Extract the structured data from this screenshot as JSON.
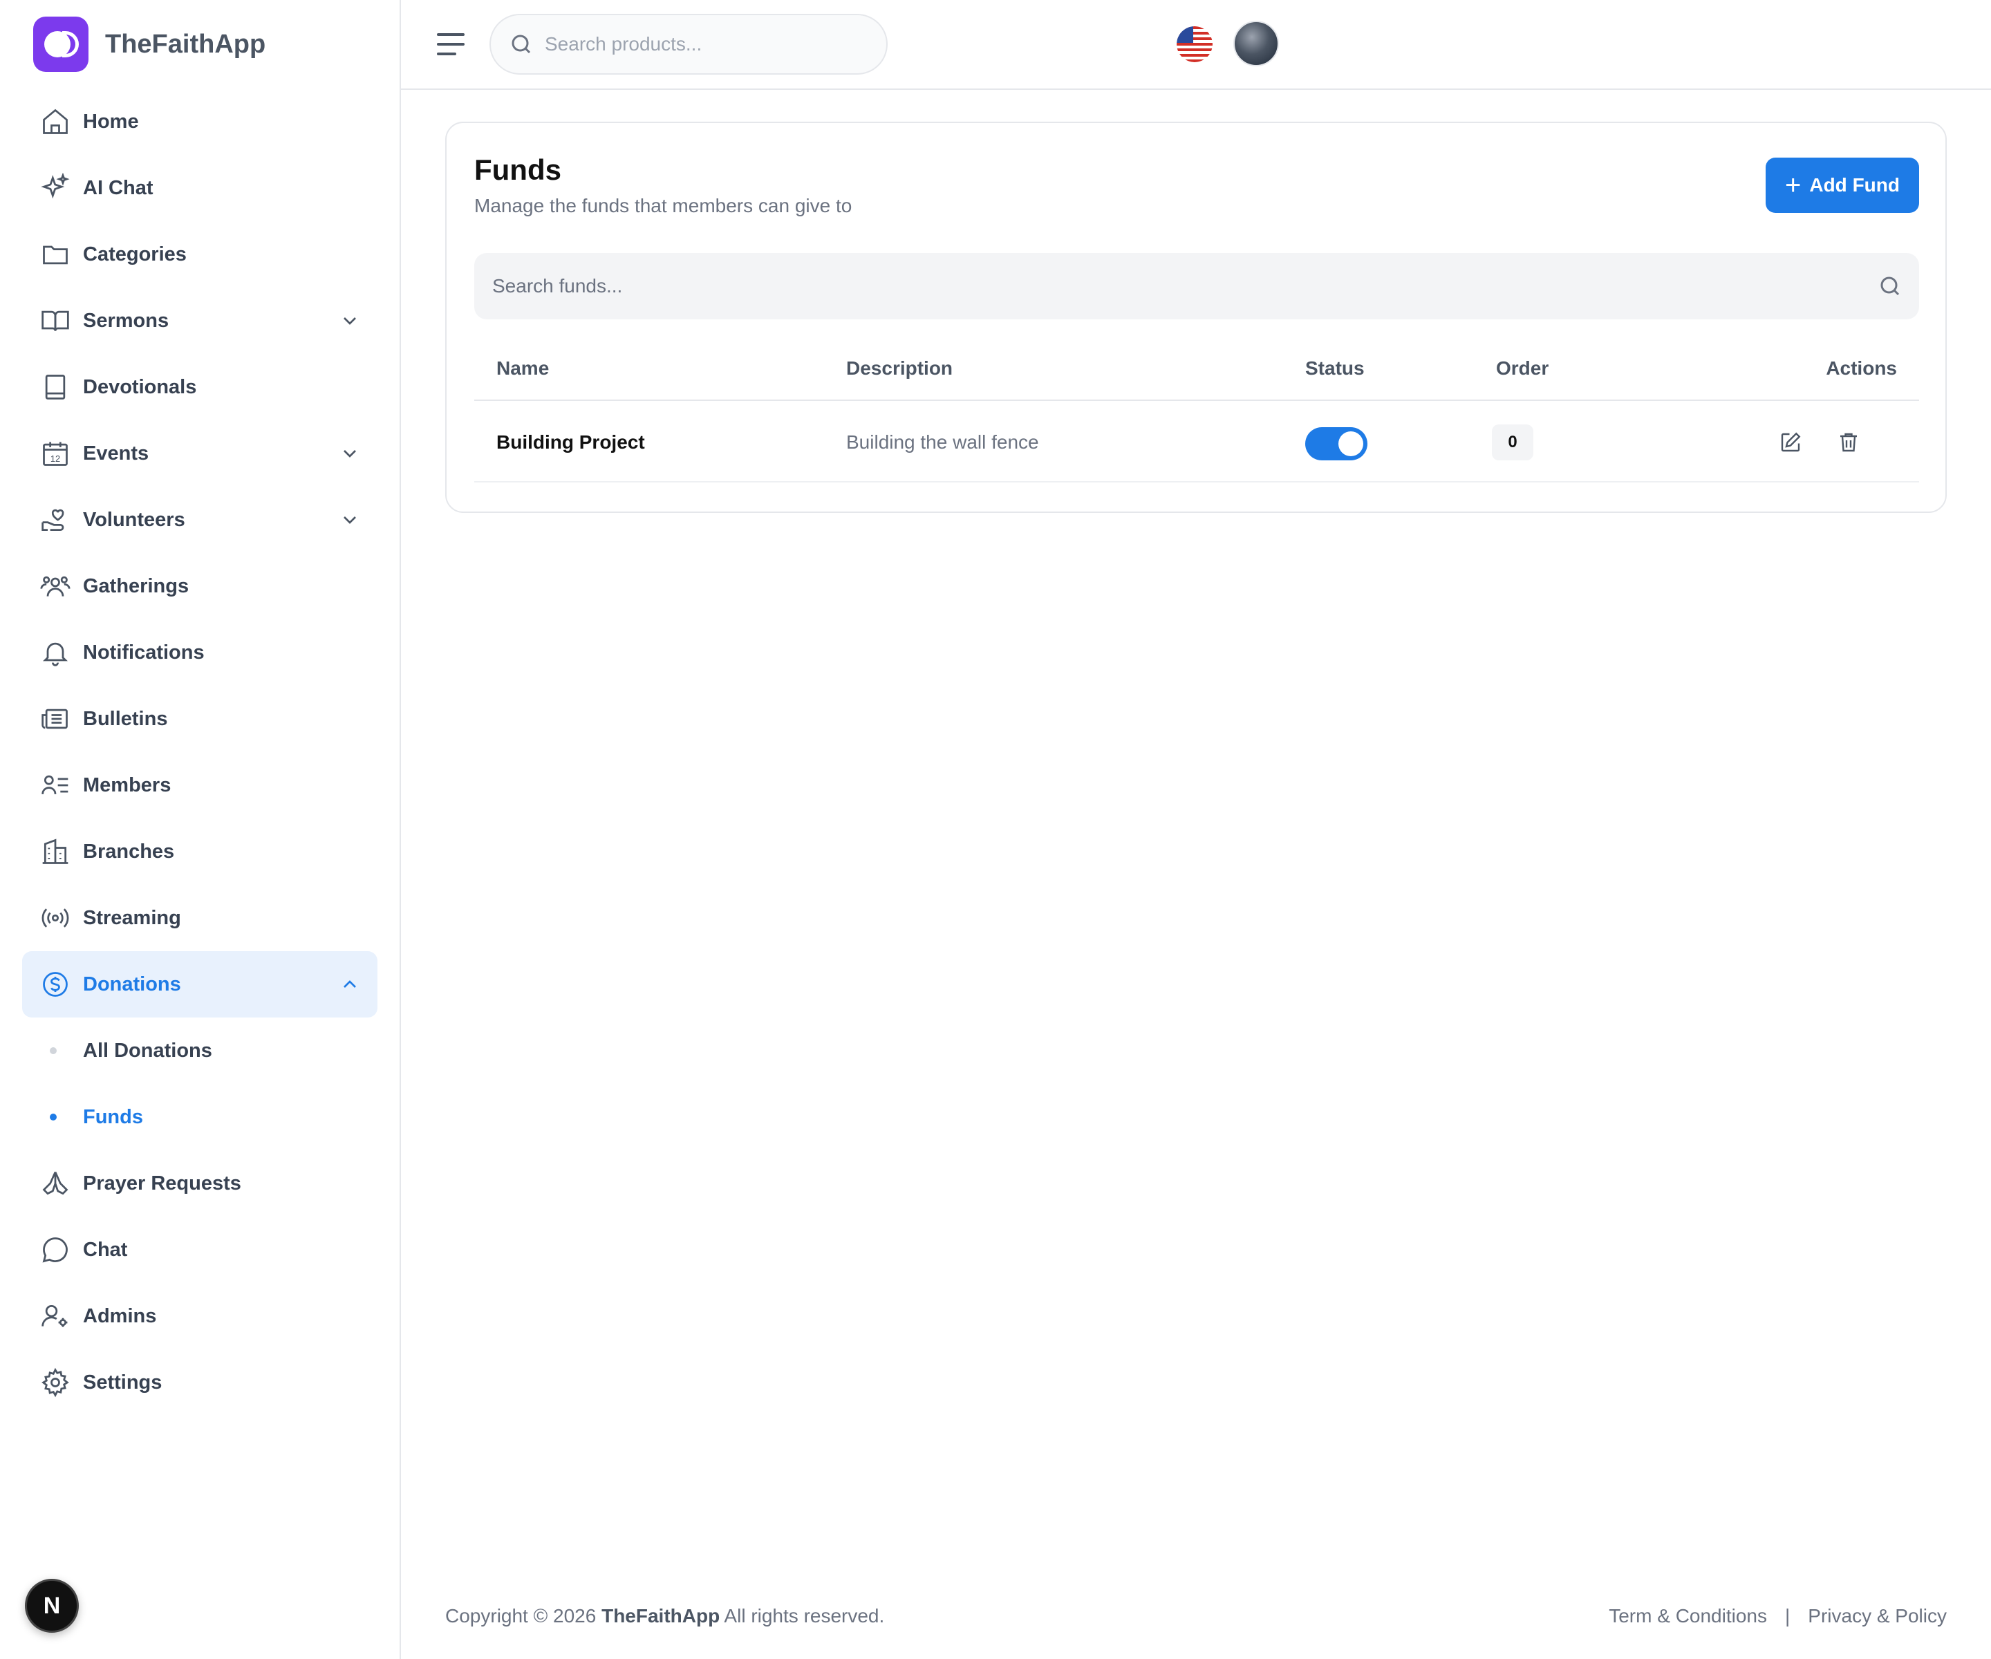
{
  "brand": {
    "name": "TheFaithApp",
    "accent": "#7c3aed"
  },
  "sidebar": {
    "items": [
      {
        "label": "Home",
        "icon": "home-icon"
      },
      {
        "label": "AI Chat",
        "icon": "sparkles-icon"
      },
      {
        "label": "Categories",
        "icon": "folder-icon"
      },
      {
        "label": "Sermons",
        "icon": "book-open-icon",
        "expandable": true
      },
      {
        "label": "Devotionals",
        "icon": "book-icon"
      },
      {
        "label": "Events",
        "icon": "calendar-icon",
        "expandable": true
      },
      {
        "label": "Volunteers",
        "icon": "hand-heart-icon",
        "expandable": true
      },
      {
        "label": "Gatherings",
        "icon": "users-icon"
      },
      {
        "label": "Notifications",
        "icon": "bell-icon"
      },
      {
        "label": "Bulletins",
        "icon": "newspaper-icon"
      },
      {
        "label": "Members",
        "icon": "user-list-icon"
      },
      {
        "label": "Branches",
        "icon": "building-icon"
      },
      {
        "label": "Streaming",
        "icon": "broadcast-icon"
      },
      {
        "label": "Donations",
        "icon": "dollar-circle-icon",
        "expanded": true,
        "active": true
      }
    ],
    "donations_sub": [
      {
        "label": "All Donations"
      },
      {
        "label": "Funds",
        "active": true
      }
    ],
    "items_after": [
      {
        "label": "Prayer Requests",
        "icon": "praying-hands-icon"
      },
      {
        "label": "Chat",
        "icon": "chat-bubble-icon"
      },
      {
        "label": "Admins",
        "icon": "user-gear-icon"
      },
      {
        "label": "Settings",
        "icon": "gear-icon"
      }
    ],
    "badge": "N"
  },
  "topbar": {
    "search_placeholder": "Search products...",
    "language_icon": "us-flag-icon"
  },
  "funds": {
    "title": "Funds",
    "subtitle": "Manage the funds that members can give to",
    "add_button": "Add Fund",
    "search_placeholder": "Search funds...",
    "columns": [
      "Name",
      "Description",
      "Status",
      "Order",
      "Actions"
    ],
    "rows": [
      {
        "name": "Building Project",
        "description": "Building the wall fence",
        "status": true,
        "order": "0"
      }
    ]
  },
  "footer": {
    "copyright_prefix": "Copyright © 2026",
    "brand": "TheFaithApp",
    "copyright_suffix": "All rights reserved.",
    "terms": "Term & Conditions",
    "separator": "|",
    "privacy": "Privacy & Policy"
  },
  "colors": {
    "primary": "#1e7be6",
    "active_bg": "#e8f1fd"
  }
}
